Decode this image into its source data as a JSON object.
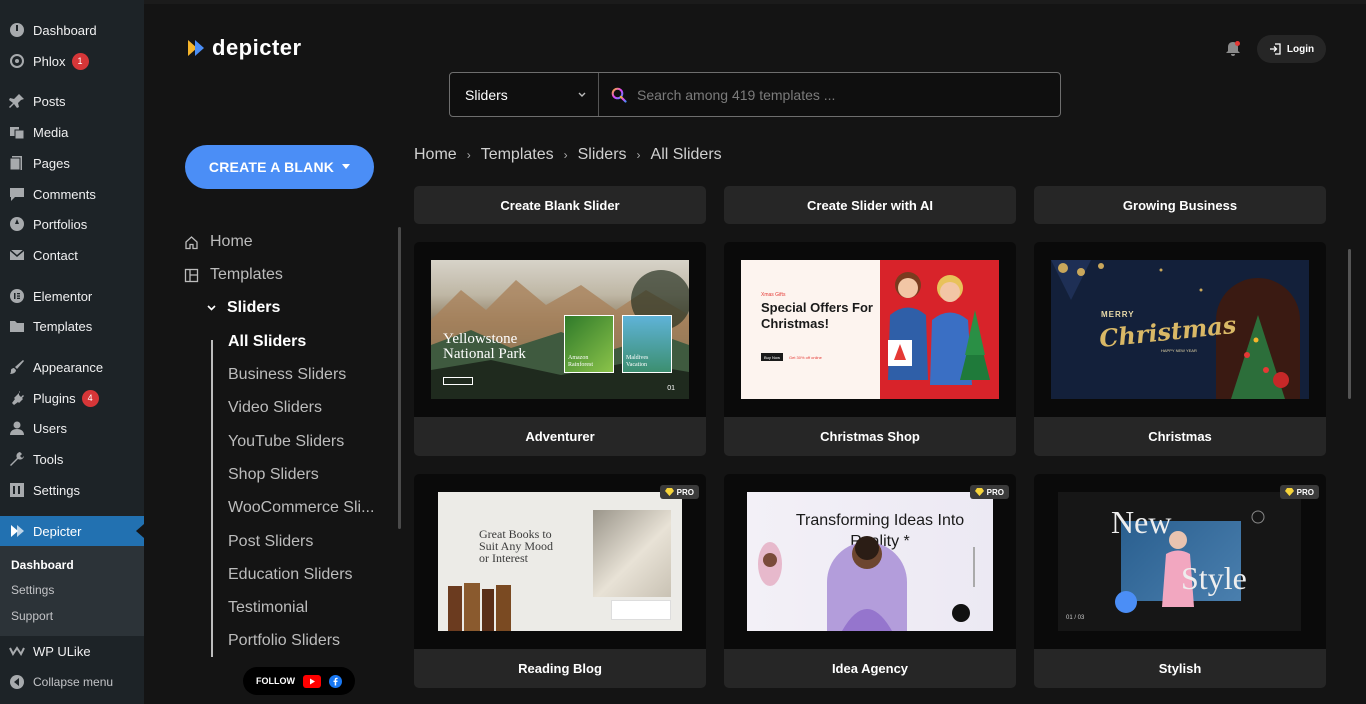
{
  "wp_menu": {
    "items": [
      {
        "label": "Dashboard",
        "icon": "dashboard-icon"
      },
      {
        "label": "Phlox",
        "icon": "phlox-icon",
        "badge": "1"
      },
      {
        "label": "Posts",
        "icon": "pin-icon"
      },
      {
        "label": "Media",
        "icon": "media-icon"
      },
      {
        "label": "Pages",
        "icon": "pages-icon"
      },
      {
        "label": "Comments",
        "icon": "comments-icon"
      },
      {
        "label": "Portfolios",
        "icon": "portfolio-icon"
      },
      {
        "label": "Contact",
        "icon": "mail-icon"
      },
      {
        "label": "Elementor",
        "icon": "elementor-icon"
      },
      {
        "label": "Templates",
        "icon": "folder-icon"
      },
      {
        "label": "Appearance",
        "icon": "brush-icon"
      },
      {
        "label": "Plugins",
        "icon": "plug-icon",
        "badge": "4"
      },
      {
        "label": "Users",
        "icon": "user-icon"
      },
      {
        "label": "Tools",
        "icon": "wrench-icon"
      },
      {
        "label": "Settings",
        "icon": "settings-icon"
      },
      {
        "label": "Depicter",
        "icon": "depicter-icon"
      },
      {
        "label": "WP ULike",
        "icon": "ulike-icon"
      },
      {
        "label": "Collapse menu",
        "icon": "collapse-icon"
      }
    ],
    "submenu": [
      "Dashboard",
      "Settings",
      "Support"
    ]
  },
  "app": {
    "logo_text": "depicter",
    "login_label": "Login",
    "accent": "#4b8ef6"
  },
  "search": {
    "category": "Sliders",
    "placeholder": "Search among 419 templates ..."
  },
  "create_button": "CREATE A BLANK",
  "nav": {
    "home": "Home",
    "templates": "Templates",
    "sliders": "Sliders",
    "items": [
      "All Sliders",
      "Business Sliders",
      "Video Sliders",
      "YouTube Sliders",
      "Shop Sliders",
      "WooCommerce Sli...",
      "Post Sliders",
      "Education Sliders",
      "Testimonial",
      "Portfolio Sliders"
    ],
    "follow": "FOLLOW"
  },
  "breadcrumb": [
    "Home",
    "Templates",
    "Sliders",
    "All Sliders"
  ],
  "top_row": [
    "Create Blank Slider",
    "Create Slider with AI",
    "Growing Business"
  ],
  "cards": [
    {
      "title": "Adventurer",
      "pro": false,
      "thumb_text": "Yellowstone National Park",
      "thumb_sub": [
        "Amazon Rainforest",
        "Maldives Vacation"
      ],
      "thumb_page": "01"
    },
    {
      "title": "Christmas Shop",
      "pro": false,
      "thumb_text": "Special Offers For Christmas!",
      "thumb_small": "Xmas Gifts",
      "thumb_btn": "Buy Now",
      "thumb_off": "Get 30% off online"
    },
    {
      "title": "Christmas",
      "pro": false,
      "thumb_text": "Christmas",
      "thumb_small": "MERRY",
      "thumb_sub": "HAPPY NEW YEAR"
    },
    {
      "title": "Reading Blog",
      "pro": true,
      "thumb_text": "Great Books to Suit Any Mood or Interest"
    },
    {
      "title": "Idea Agency",
      "pro": true,
      "thumb_text": "Transforming Ideas Into Reality *"
    },
    {
      "title": "Stylish",
      "pro": true,
      "thumb_text": "New",
      "thumb_text2": "Style",
      "thumb_page": "01 / 03"
    }
  ],
  "pro_label": "PRO"
}
